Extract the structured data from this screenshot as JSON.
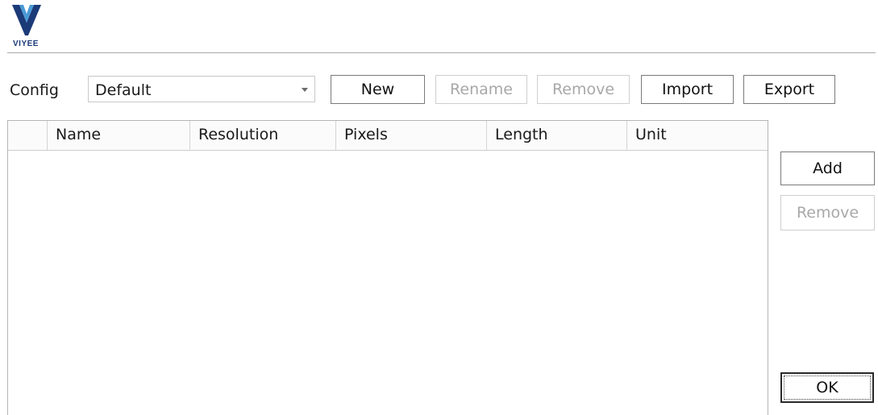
{
  "brand": {
    "logo_text": "VIYEE",
    "color": "#1b3a78"
  },
  "config": {
    "label": "Config",
    "selected": "Default"
  },
  "toolbar": {
    "new_label": "New",
    "rename_label": "Rename",
    "remove_label": "Remove",
    "import_label": "Import",
    "export_label": "Export"
  },
  "table": {
    "columns": [
      "Name",
      "Resolution",
      "Pixels",
      "Length",
      "Unit"
    ],
    "rows": []
  },
  "side": {
    "add_label": "Add",
    "remove_label": "Remove",
    "ok_label": "OK"
  }
}
